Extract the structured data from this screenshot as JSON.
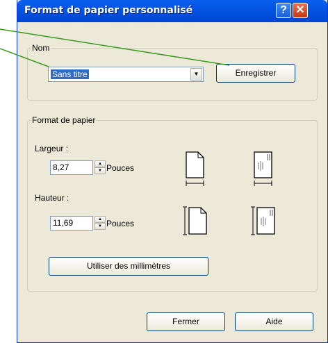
{
  "window": {
    "title": "Format de papier personnalisé",
    "help_glyph": "?",
    "close_glyph": "✕"
  },
  "nom": {
    "legend": "Nom",
    "selected": "Sans titre",
    "save_label": "Enregistrer"
  },
  "paper": {
    "legend": "Format de papier",
    "width_label": "Largeur :",
    "width_value": "8,27",
    "height_label": "Hauteur :",
    "height_value": "11,69",
    "unit": "Pouces",
    "mm_button": "Utiliser des millimètres"
  },
  "footer": {
    "close_label": "Fermer",
    "help_label": "Aide"
  },
  "colors": {
    "callout_line": "#3c9a1f",
    "titlebar": "#0554e3"
  }
}
